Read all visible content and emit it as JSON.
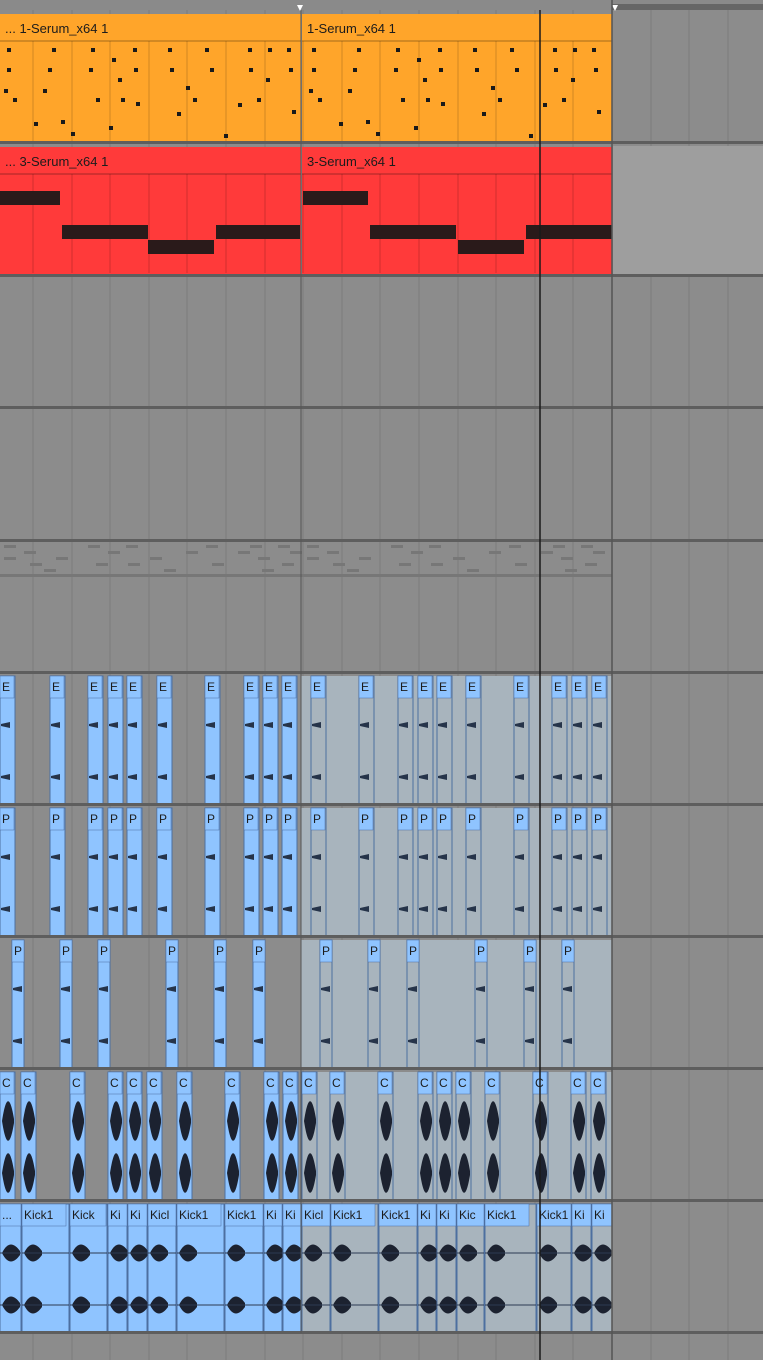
{
  "colors": {
    "background": "#8c8c8c",
    "track_separator": "#5e5e5e",
    "grid_line": "#7c7c7c",
    "top_bar": "#666666",
    "track1_clip": "#ffa52a",
    "track1_clip_header": "#ffa52a",
    "track2_clip": "#ff3a3a",
    "track2_clip_header": "#ff3a3a",
    "audio_clip_active": "#8fc4ff",
    "audio_clip_inactive": "#a8b4bd",
    "note_dark": "#2a1a1a",
    "playhead": "#1a1a1a",
    "loop_region": "#9e9e9e"
  },
  "tracks": [
    {
      "id": "track-1",
      "type": "midi",
      "clips": [
        {
          "name": "... 1-Serum_x64 1",
          "part": "a"
        },
        {
          "name": "1-Serum_x64 1",
          "part": "b"
        }
      ]
    },
    {
      "id": "track-2",
      "type": "midi",
      "clips": [
        {
          "name": "... 3-Serum_x64 1",
          "part": "a"
        },
        {
          "name": "3-Serum_x64 1",
          "part": "b"
        }
      ]
    },
    {
      "id": "track-3",
      "type": "empty"
    },
    {
      "id": "track-4",
      "type": "empty"
    },
    {
      "id": "track-5",
      "type": "folded-midi"
    },
    {
      "id": "track-6",
      "type": "audio",
      "clip_labels": [
        "E",
        "E",
        "E",
        "E",
        "E",
        "E",
        "E",
        "E",
        "E",
        "E",
        "E",
        "E",
        "E",
        "E",
        "E",
        "E",
        "E",
        "E",
        "E",
        "E",
        "E"
      ]
    },
    {
      "id": "track-7",
      "type": "audio",
      "clip_labels": [
        "P",
        "P",
        "P",
        "P",
        "P",
        "P",
        "P",
        "P",
        "P",
        "P",
        "P",
        "P",
        "P",
        "P",
        "P",
        "P",
        "P",
        "P",
        "P",
        "P",
        "P"
      ]
    },
    {
      "id": "track-8",
      "type": "audio",
      "clip_labels": [
        "P",
        "P",
        "P",
        "P",
        "P",
        "P",
        "P",
        "P",
        "P",
        "P",
        "P",
        "P"
      ]
    },
    {
      "id": "track-9",
      "type": "audio",
      "clip_labels": [
        "C",
        "C",
        "C",
        "C",
        "C",
        "C",
        "C",
        "C",
        "C",
        "C",
        "C",
        "C",
        "C",
        "C",
        "C",
        "C",
        "C",
        "C",
        "C",
        "C"
      ]
    },
    {
      "id": "track-10",
      "type": "audio",
      "clip_labels": [
        "...",
        "Kick1",
        "Kick",
        "Ki",
        "Ki",
        "Kicl",
        "Kick1",
        "Kick1",
        "Ki",
        "Ki",
        "Kicl",
        "Kick1",
        "Kick1",
        "Ki",
        "Ki",
        "Kic",
        "Kick1",
        "Kick1",
        "Ki",
        "Ki"
      ]
    }
  ]
}
